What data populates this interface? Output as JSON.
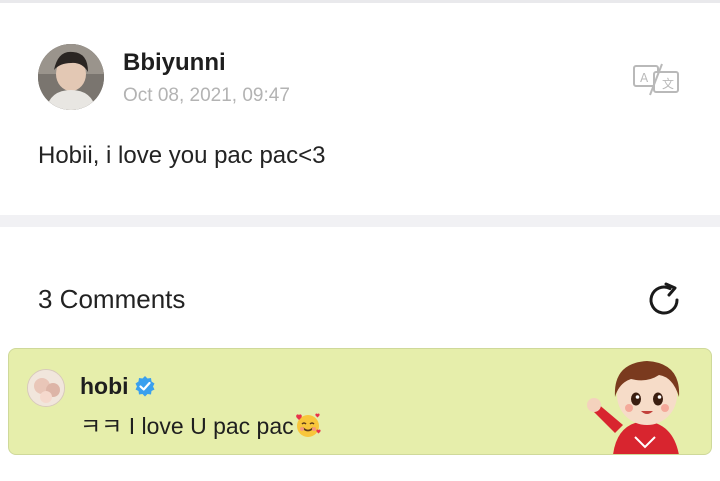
{
  "post": {
    "author": "Bbiyunni",
    "timestamp": "Oct 08, 2021, 09:47",
    "body": "Hobii, i  love you pac pac<3",
    "translate_icon": "translate-icon"
  },
  "comments": {
    "count_label": "3 Comments",
    "refresh_icon": "refresh-icon",
    "items": [
      {
        "author": "hobi",
        "verified": true,
        "text": "ㅋㅋ I love U pac pac",
        "emoji": "smiling-face-with-hearts",
        "card_color": "#e6eeab"
      }
    ]
  },
  "colors": {
    "verified_badge": "#3aa0ee",
    "timestamp": "#b3b3b3",
    "divider": "#f1f1f4"
  }
}
